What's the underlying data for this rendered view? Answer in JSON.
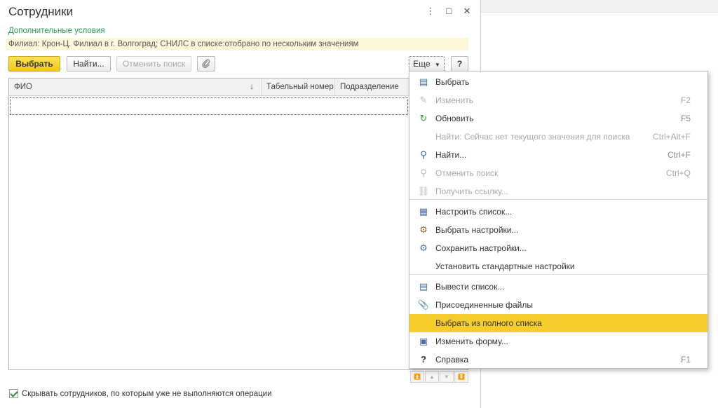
{
  "window": {
    "title": "Сотрудники",
    "more_icon": "⋮",
    "maximize_icon": "□",
    "close_icon": "✕"
  },
  "extra_conditions_label": "Дополнительные условия",
  "filter_text": "Филиал: Крон-Ц. Филиал в г. Волгоград; СНИЛС в списке:отобрано по нескольким значениям",
  "toolbar": {
    "select_label": "Выбрать",
    "find_label": "Найти...",
    "cancel_search_label": "Отменить поиск",
    "attach_icon": "paperclip-icon",
    "more_label": "Еще",
    "help_label": "?"
  },
  "table": {
    "columns": [
      "ФИО",
      "Табельный номер",
      "Подразделение"
    ],
    "sort_indicator": "↓"
  },
  "scroll_buttons": [
    "⏫",
    "▲",
    "▼",
    "⏬"
  ],
  "footer": {
    "checkbox_label": "Скрывать сотрудников, по которым уже не выполняются операции",
    "checked": true
  },
  "menu": {
    "items": [
      {
        "icon": "select-icon",
        "glyph": "▤",
        "label": "Выбрать",
        "shortcut": "",
        "disabled": false,
        "highlight": false
      },
      {
        "icon": "pencil-icon",
        "glyph": "✎",
        "label": "Изменить",
        "shortcut": "F2",
        "disabled": true,
        "highlight": false
      },
      {
        "icon": "refresh-icon",
        "glyph": "↻",
        "label": "Обновить",
        "shortcut": "F5",
        "disabled": false,
        "highlight": false
      },
      {
        "icon": "",
        "glyph": "",
        "label": "Найти: Сейчас нет текущего значения для поиска",
        "shortcut": "Ctrl+Alt+F",
        "disabled": true,
        "highlight": false
      },
      {
        "icon": "search-icon",
        "glyph": "⚲",
        "label": "Найти...",
        "shortcut": "Ctrl+F",
        "disabled": false,
        "highlight": false
      },
      {
        "icon": "cancel-search-icon",
        "glyph": "⚲",
        "label": "Отменить поиск",
        "shortcut": "Ctrl+Q",
        "disabled": true,
        "highlight": false
      },
      {
        "icon": "link-icon",
        "glyph": "⛓",
        "label": "Получить ссылку...",
        "shortcut": "",
        "disabled": true,
        "highlight": false
      },
      {
        "icon": "configure-list-icon",
        "glyph": "▦",
        "label": "Настроить список...",
        "shortcut": "",
        "disabled": false,
        "highlight": false
      },
      {
        "icon": "choose-settings-icon",
        "glyph": "⚙",
        "label": "Выбрать настройки...",
        "shortcut": "",
        "disabled": false,
        "highlight": false
      },
      {
        "icon": "save-settings-icon",
        "glyph": "⚙",
        "label": "Сохранить настройки...",
        "shortcut": "",
        "disabled": false,
        "highlight": false
      },
      {
        "icon": "",
        "glyph": "",
        "label": "Установить стандартные настройки",
        "shortcut": "",
        "disabled": false,
        "highlight": false
      },
      {
        "icon": "print-list-icon",
        "glyph": "▤",
        "label": "Вывести список...",
        "shortcut": "",
        "disabled": false,
        "highlight": false
      },
      {
        "icon": "attachment-icon",
        "glyph": "📎",
        "label": "Присоединенные файлы",
        "shortcut": "",
        "disabled": false,
        "highlight": false
      },
      {
        "icon": "",
        "glyph": "",
        "label": "Выбрать из полного списка",
        "shortcut": "",
        "disabled": false,
        "highlight": true
      },
      {
        "icon": "change-form-icon",
        "glyph": "▣",
        "label": "Изменить форму...",
        "shortcut": "",
        "disabled": false,
        "highlight": false
      },
      {
        "icon": "help-icon",
        "glyph": "?",
        "label": "Справка",
        "shortcut": "F1",
        "disabled": false,
        "highlight": false
      }
    ]
  },
  "colors": {
    "accent_yellow": "#f6cd2a",
    "link_green": "#2a9d4e",
    "filter_bg": "#fdf8d9"
  }
}
